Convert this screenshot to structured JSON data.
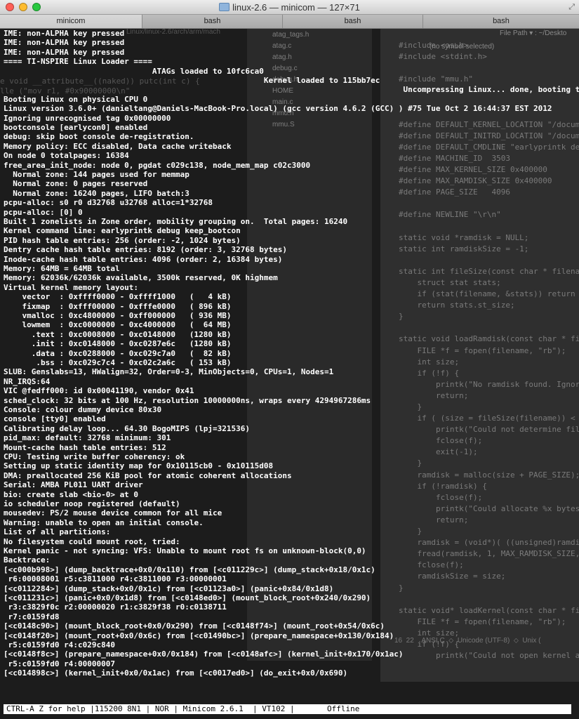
{
  "window": {
    "title": "linux-2.6 — minicom — 127×71",
    "traffic_lights": {
      "close": "#ff5f57",
      "minimize": "#febc2e",
      "zoom": "#28c840"
    },
    "folder_icon": "folder-icon",
    "resize_glyph": "⤢"
  },
  "tabs": [
    "minicom",
    "bash",
    "bash",
    "bash"
  ],
  "background_editor": {
    "files": [
      "atag_tags.h",
      "atag.c",
      "atag.h",
      "debug.c",
      "debug.h",
      "HOME",
      "main.c",
      "mmu.h",
      "mmu.S"
    ],
    "header_left": "(no symbol selected)",
    "header_right": "File Path ▾ : ~/Deskto",
    "code": [
      "#include <os.h>",
      "#include <stdint.h>",
      "",
      "#include \"mmu.h\"",
      "",
      "",
      "",
      "#define DEFAULT_KERNEL_LOCATION \"/docum",
      "#define DEFAULT_INITRD_LOCATION \"/docum",
      "#define DEFAULT_CMDLINE \"earlyprintk de",
      "#define MACHINE_ID  3503",
      "#define MAX_KERNEL_SIZE 0x400000",
      "#define MAX_RAMDISK_SIZE 0x400000",
      "#define PAGE_SIZE   4096",
      "",
      "#define NEWLINE \"\\r\\n\"",
      "",
      "static void *ramdisk = NULL;",
      "static int ramdiskSize = -1;",
      "",
      "static int fileSize(const char * filena",
      "    struct stat stats;",
      "    if (stat(filename, &stats)) return",
      "    return stats.st_size;",
      "}",
      "",
      "static void loadRamdisk(const char * fil",
      "    FILE *f = fopen(filename, \"rb\");",
      "    int size;",
      "    if (!f) {",
      "        printk(\"No ramdisk found. Ignor",
      "        return;",
      "    }",
      "    if ( (size = fileSize(filename)) <",
      "        printk(\"Could not determine fil",
      "        fclose(f);",
      "        exit(-1);",
      "    }",
      "    ramdisk = malloc(size + PAGE_SIZE);",
      "    if (!ramdisk) {",
      "        fclose(f);",
      "        printk(\"Could allocate %x bytes",
      "        return;",
      "    }",
      "    ramdisk = (void*)( ((unsigned)ramdi",
      "    fread(ramdisk, 1, MAX_RAMDISK_SIZE,",
      "    fclose(f);",
      "    ramdiskSize = size;",
      "}",
      "",
      "static void* loadKernel(const char * fil",
      "    FILE *f = fopen(filename, \"rb\");",
      "    int size;",
      "    if (!f) {",
      "        printk(\"Could not open kernel a"
    ],
    "status": "16  22    ANSI C  ⬦  Unicode (UTF-8)  ⬦  Unix (",
    "ghost_left": [
      "e void __attribute__((naked)) putc(int c) {",
      "lle (\"mov r1, #0x90000000\\n\""
    ],
    "ghost_path": "Linux/linux-2.6/arch/arm/mach"
  },
  "terminal": {
    "lines": [
      "IME: non-ALPHA key pressed",
      "IME: non-ALPHA key pressed",
      "IME: non-ALPHA key pressed",
      "==== TI-NSPIRE Linux Loader ====",
      "                                ATAGs loaded to 10fc6ca0",
      "                                                        Kernel loaded to 115bb7ec",
      "                                                                                      Uncompressing Linux... done, booting the kern.",
      "Booting Linux on physical CPU 0",
      "Linux version 3.6.0+ (danieltang@Daniels-MacBook-Pro.local) (gcc version 4.6.2 (GCC) ) #75 Tue Oct 2 16:44:37 EST 2012",
      "Ignoring unrecognised tag 0x00000000",
      "bootconsole [earlycon0] enabled",
      "debug: skip boot console de-registration.",
      "Memory policy: ECC disabled, Data cache writeback",
      "On node 0 totalpages: 16384",
      "free_area_init_node: node 0, pgdat c029c138, node_mem_map c02c3000",
      "  Normal zone: 144 pages used for memmap",
      "  Normal zone: 0 pages reserved",
      "  Normal zone: 16240 pages, LIFO batch:3",
      "pcpu-alloc: s0 r0 d32768 u32768 alloc=1*32768",
      "pcpu-alloc: [0] 0",
      "Built 1 zonelists in Zone order, mobility grouping on.  Total pages: 16240",
      "Kernel command line: earlyprintk debug keep_bootcon",
      "PID hash table entries: 256 (order: -2, 1024 bytes)",
      "Dentry cache hash table entries: 8192 (order: 3, 32768 bytes)",
      "Inode-cache hash table entries: 4096 (order: 2, 16384 bytes)",
      "Memory: 64MB = 64MB total",
      "Memory: 62036k/62036k available, 3500k reserved, 0K highmem",
      "Virtual kernel memory layout:",
      "    vector  : 0xffff0000 - 0xffff1000   (   4 kB)",
      "    fixmap  : 0xfff00000 - 0xfffe0000   ( 896 kB)",
      "    vmalloc : 0xc4800000 - 0xff000000   ( 936 MB)",
      "    lowmem  : 0xc0000000 - 0xc4000000   (  64 MB)",
      "      .text : 0xc0008000 - 0xc0148000   (1280 kB)",
      "      .init : 0xc0148000 - 0xc0287e6c   (1280 kB)",
      "      .data : 0xc0288000 - 0xc029c7a0   (  82 kB)",
      "       .bss : 0xc029c7c4 - 0xc02c2a6c   ( 153 kB)",
      "SLUB: Genslabs=13, HWalign=32, Order=0-3, MinObjects=0, CPUs=1, Nodes=1",
      "NR_IRQS:64",
      "VIC @fedff000: id 0x00041190, vendor 0x41",
      "sched_clock: 32 bits at 100 Hz, resolution 10000000ns, wraps every 4294967286ms",
      "Console: colour dummy device 80x30",
      "console [tty0] enabled",
      "Calibrating delay loop... 64.30 BogoMIPS (lpj=321536)",
      "pid_max: default: 32768 minimum: 301",
      "Mount-cache hash table entries: 512",
      "CPU: Testing write buffer coherency: ok",
      "Setting up static identity map for 0x10115cb0 - 0x10115d08",
      "DMA: preallocated 256 KiB pool for atomic coherent allocations",
      "Serial: AMBA PL011 UART driver",
      "bio: create slab <bio-0> at 0",
      "io scheduler noop registered (default)",
      "mousedev: PS/2 mouse device common for all mice",
      "Warning: unable to open an initial console.",
      "List of all partitions:",
      "No filesystem could mount root, tried:",
      "Kernel panic - not syncing: VFS: Unable to mount root fs on unknown-block(0,0)",
      "Backtrace:",
      "[<c000b998>] (dump_backtrace+0x0/0x110) from [<c011229c>] (dump_stack+0x18/0x1c)",
      " r6:00008001 r5:c3811000 r4:c3811000 r3:00000001",
      "[<c0112284>] (dump_stack+0x0/0x1c) from [<c01123a0>] (panic+0x84/0x1d8)",
      "[<c011231c>] (panic+0x0/0x1d8) from [<c0148ed0>] (mount_block_root+0x240/0x290)",
      " r3:c3829f0c r2:00000020 r1:c3829f38 r0:c0138711",
      " r7:c0159fd8",
      "[<c0148c90>] (mount_block_root+0x0/0x290) from [<c0148f74>] (mount_root+0x54/0x6c)",
      "[<c0148f20>] (mount_root+0x0/0x6c) from [<c01490bc>] (prepare_namespace+0x130/0x184)",
      " r5:c0159fd0 r4:c029c840",
      "[<c0148f8c>] (prepare_namespace+0x0/0x184) from [<c0148afc>] (kernel_init+0x170/0x1ac)",
      " r5:c0159fd0 r4:00000007",
      "[<c014898c>] (kernel_init+0x0/0x1ac) from [<c0017ed0>] (do_exit+0x0/0x690)"
    ],
    "status_bar": "CTRL-A Z for help |115200 8N1 | NOR | Minicom 2.6.1  | VT102 |       Offline"
  }
}
